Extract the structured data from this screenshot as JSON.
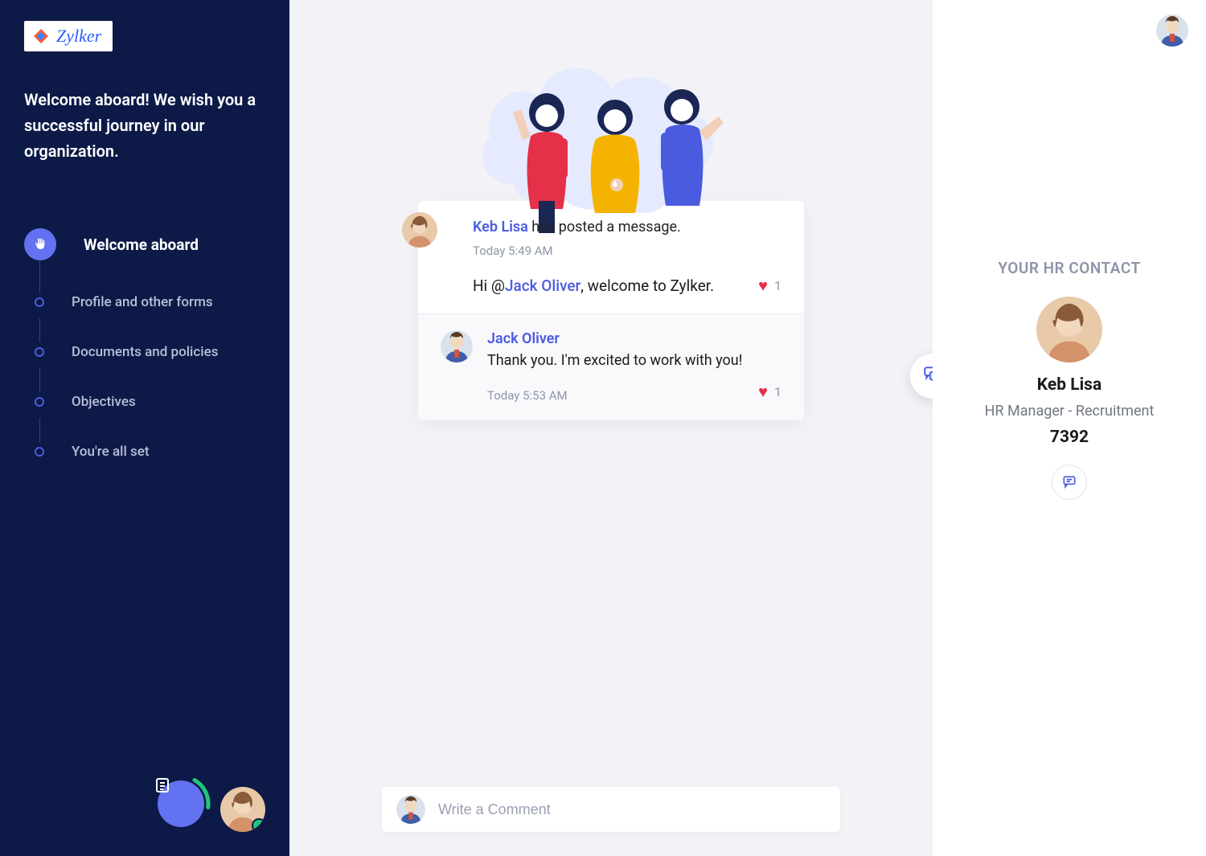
{
  "logo": {
    "text": "Zylker"
  },
  "sidebar": {
    "welcome": "Welcome aboard! We wish you a successful journey in our organization.",
    "steps": [
      {
        "label": "Welcome aboard",
        "active": true
      },
      {
        "label": "Profile and other forms",
        "active": false
      },
      {
        "label": "Documents and policies",
        "active": false
      },
      {
        "label": "Objectives",
        "active": false
      },
      {
        "label": "You're all set",
        "active": false
      }
    ]
  },
  "feed": {
    "post": {
      "author": "Keb Lisa",
      "action": " has posted a message.",
      "time": "Today 5:49 AM",
      "msg_pre": "Hi @",
      "mention": "Jack Oliver",
      "msg_post": ", welcome to Zylker.",
      "likes": "1"
    },
    "reply": {
      "author": "Jack Oliver",
      "text": "Thank you. I'm excited to work with you!",
      "time": "Today 5:53 AM",
      "likes": "1"
    }
  },
  "comment": {
    "placeholder": "Write a Comment"
  },
  "right": {
    "header": "YOUR HR CONTACT",
    "name": "Keb Lisa",
    "title": "HR Manager - Recruitment",
    "ext": "7392"
  }
}
